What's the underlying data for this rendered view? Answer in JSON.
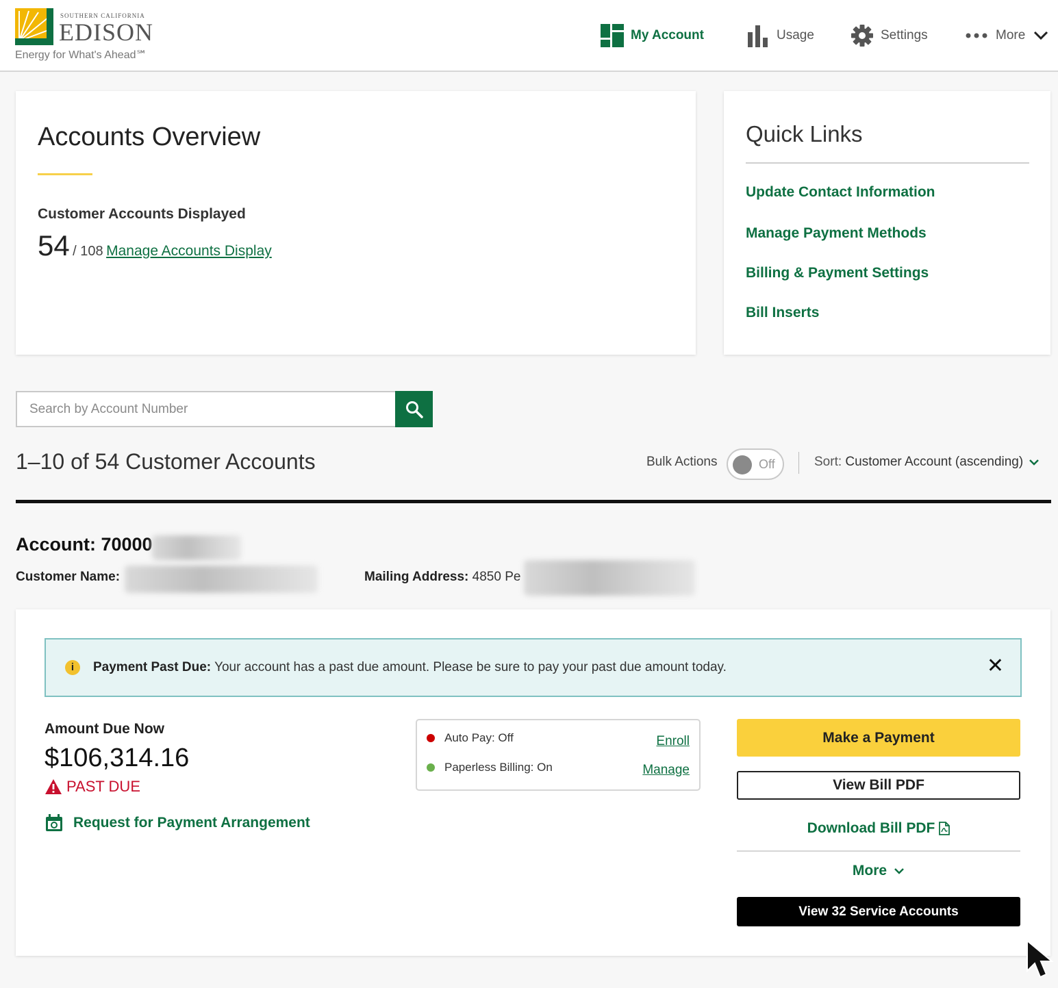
{
  "brand": {
    "small": "SOUTHERN CALIFORNIA",
    "name": "EDISON",
    "tagline": "Energy for What's Ahead℠",
    "colors": {
      "green": "#0e7042",
      "gold": "#f7d04a",
      "yellow_button": "#fad03c",
      "alert_red": "#c8102e"
    }
  },
  "nav": {
    "items": [
      {
        "label": "My Account",
        "icon": "dashboard-icon",
        "active": true
      },
      {
        "label": "Usage",
        "icon": "bar-chart-icon"
      },
      {
        "label": "Settings",
        "icon": "gear-icon"
      },
      {
        "label": "More",
        "icon": "ellipsis-icon"
      }
    ]
  },
  "overview": {
    "title": "Accounts Overview",
    "displayed_label": "Customer Accounts Displayed",
    "displayed_count": "54",
    "total": "/ 108",
    "manage_link": "Manage Accounts Display"
  },
  "quick_links": {
    "title": "Quick Links",
    "links": [
      "Update Contact Information",
      "Manage Payment Methods",
      "Billing & Payment Settings",
      "Bill Inserts"
    ]
  },
  "search": {
    "placeholder": "Search by Account Number",
    "icon": "search-icon"
  },
  "list": {
    "title": "1–10 of 54 Customer Accounts",
    "bulk_actions_label": "Bulk Actions",
    "bulk_toggle_state": "Off",
    "sort_prefix": "Sort:",
    "sort_value": "Customer Account (ascending)"
  },
  "account": {
    "title": "Account: 70000",
    "customer_name_label": "Customer Name:",
    "mailing_address_label": "Mailing Address:",
    "mailing_address_partial": "4850 Pe",
    "alert": {
      "title": "Payment Past Due:",
      "message": "Your account has a past due amount. Please be sure to pay your past due amount today.",
      "close": "✕"
    },
    "amount_due_label": "Amount Due Now",
    "amount_due": "$106,314.16",
    "past_due_label": "PAST DUE",
    "arrangement_link": "Request for Payment Arrangement",
    "auto_pay": {
      "label": "Auto Pay: Off",
      "link": "Enroll",
      "status_color": "#cc0000"
    },
    "paperless": {
      "label": "Paperless Billing: On",
      "link": "Manage",
      "status_color": "#6ab04c"
    },
    "actions": {
      "make_payment": "Make a Payment",
      "view_bill": "View Bill PDF",
      "download_bill": "Download Bill PDF",
      "more": "More",
      "view_service": "View 32 Service Accounts"
    }
  }
}
